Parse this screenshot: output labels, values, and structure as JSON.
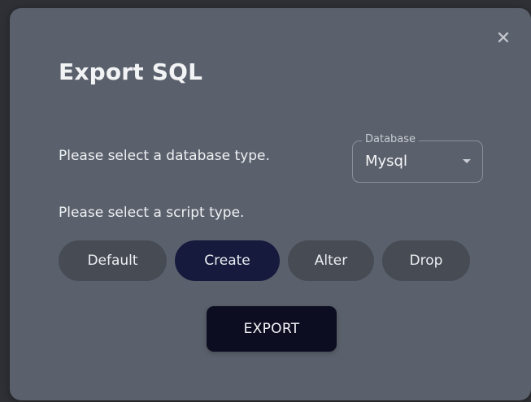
{
  "dialog": {
    "title": "Export SQL",
    "close_icon": "close-icon",
    "database_prompt": "Please select a database type.",
    "database_select": {
      "legend": "Database",
      "value": "Mysql"
    },
    "script_prompt": "Please select a script type.",
    "script_types": [
      {
        "label": "Default",
        "selected": false
      },
      {
        "label": "Create",
        "selected": true
      },
      {
        "label": "Alter",
        "selected": false
      },
      {
        "label": "Drop",
        "selected": false
      }
    ],
    "export_label": "EXPORT"
  },
  "colors": {
    "dialog_bg": "#5b616c",
    "chip_bg": "#464b54",
    "chip_selected_bg": "#161a3d",
    "export_bg": "#0d0d22"
  }
}
